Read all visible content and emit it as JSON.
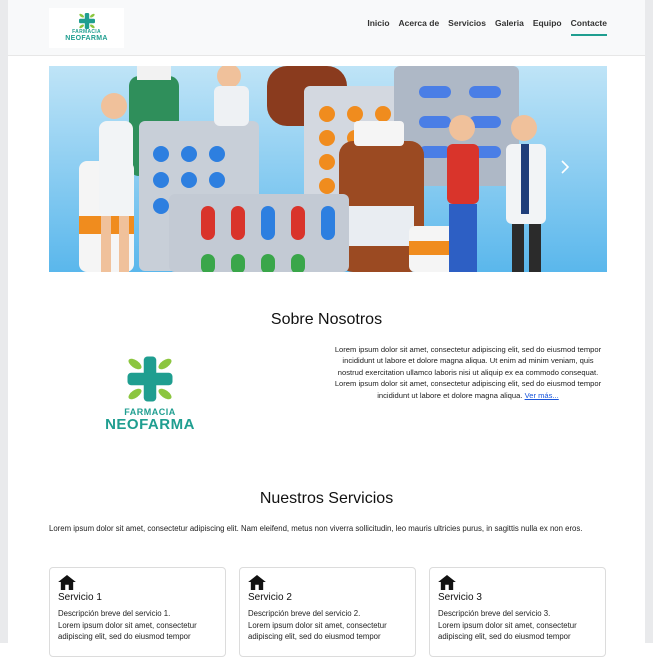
{
  "nav": {
    "brand_small": "FARMACIA",
    "brand_big": "NEOFARMA",
    "links": [
      "Inicio",
      "Acerca de",
      "Servicios",
      "Galeria",
      "Equipo",
      "Contacte"
    ]
  },
  "about": {
    "title": "Sobre Nosotros",
    "logo_small": "FARMACIA",
    "logo_big": "NEOFARMA",
    "text": "Lorem ipsum dolor sit amet, consectetur adipiscing elit, sed do eiusmod tempor incididunt ut labore et dolore magna aliqua. Ut enim ad minim veniam, quis nostrud exercitation ullamco laboris nisi ut aliquip ex ea commodo consequat. Lorem ipsum dolor sit amet, consectetur adipiscing elit, sed do eiusmod tempor incididunt ut labore et dolore magna aliqua.",
    "more_link": "Ver más..."
  },
  "services": {
    "title": "Nuestros Servicios",
    "intro": "Lorem ipsum dolor sit amet, consectetur adipiscing elit. Nam eleifend, metus non viverra sollicitudin, leo mauris ultricies purus, in sagittis nulla ex non eros.",
    "items": [
      {
        "title": "Servicio 1",
        "desc": "Descripción breve del servicio 1.",
        "body": "Lorem ipsum dolor sit amet, consectetur adipiscing elit, sed do eiusmod tempor"
      },
      {
        "title": "Servicio 2",
        "desc": "Descripción breve del servicio 2.",
        "body": "Lorem ipsum dolor sit amet, consectetur adipiscing elit, sed do eiusmod tempor"
      },
      {
        "title": "Servicio 3",
        "desc": "Descripción breve del servicio 3.",
        "body": "Lorem ipsum dolor sit amet, consectetur adipiscing elit, sed do eiusmod tempor"
      }
    ]
  },
  "colors": {
    "brand_teal": "#1f9e90",
    "leaf_green": "#8cc63f",
    "link_blue": "#1a56db",
    "hero_sky": "#bfe4f7"
  },
  "icons": [
    "plus-leaf-logo-icon",
    "house-icon",
    "chevron-right-icon"
  ]
}
